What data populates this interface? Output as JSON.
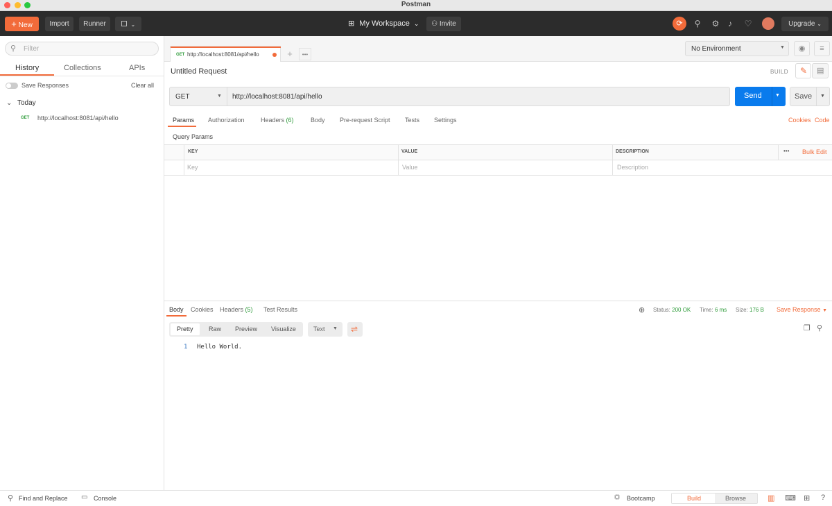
{
  "window": {
    "title": "Postman"
  },
  "header": {
    "new_label": "New",
    "import_label": "Import",
    "runner_label": "Runner",
    "workspace_label": "My Workspace",
    "invite_label": "Invite",
    "upgrade_label": "Upgrade"
  },
  "sidebar": {
    "filter_placeholder": "Filter",
    "tabs": [
      "History",
      "Collections",
      "APIs"
    ],
    "save_responses_label": "Save Responses",
    "clear_all_label": "Clear all",
    "group_label": "Today",
    "history_items": [
      {
        "method": "GET",
        "url": "http://localhost:8081/api/hello"
      }
    ]
  },
  "request_tab": {
    "method": "GET",
    "url": "http://localhost:8081/api/hello"
  },
  "environment": {
    "selected": "No Environment"
  },
  "request": {
    "name": "Untitled Request",
    "build_label": "BUILD",
    "method": "GET",
    "url": "http://localhost:8081/api/hello",
    "send_label": "Send",
    "save_label": "Save"
  },
  "request_tabs": {
    "params": "Params",
    "authorization": "Authorization",
    "headers": "Headers",
    "headers_count": "(6)",
    "body": "Body",
    "prerequest": "Pre-request Script",
    "tests": "Tests",
    "settings": "Settings",
    "cookies": "Cookies",
    "code": "Code"
  },
  "query_params": {
    "title": "Query Params",
    "headers": {
      "key": "KEY",
      "value": "VALUE",
      "description": "DESCRIPTION"
    },
    "more": "•••",
    "bulk_edit": "Bulk Edit",
    "placeholders": {
      "key": "Key",
      "value": "Value",
      "description": "Description"
    }
  },
  "response": {
    "tabs": {
      "body": "Body",
      "cookies": "Cookies",
      "headers": "Headers",
      "headers_count": "(5)",
      "test_results": "Test Results"
    },
    "status_label": "Status:",
    "status_value": "200 OK",
    "time_label": "Time:",
    "time_value": "6 ms",
    "size_label": "Size:",
    "size_value": "176 B",
    "save_response_label": "Save Response",
    "view_modes": [
      "Pretty",
      "Raw",
      "Preview",
      "Visualize"
    ],
    "format": "Text",
    "lines": [
      {
        "number": "1",
        "text": "Hello World."
      }
    ]
  },
  "footer": {
    "find_replace_label": "Find and Replace",
    "console_label": "Console",
    "bootcamp_label": "Bootcamp",
    "build_label": "Build",
    "browse_label": "Browse"
  },
  "colors": {
    "accent": "#f26b3a",
    "send_blue": "#097bed",
    "header_bg": "#2c2c2c",
    "success_green": "#2e9b3a"
  }
}
